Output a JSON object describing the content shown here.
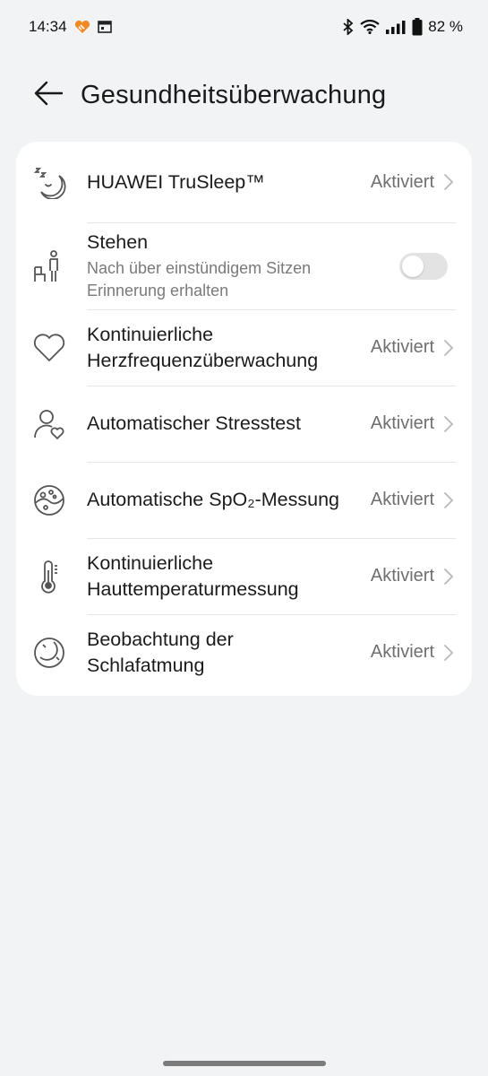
{
  "status_bar": {
    "time": "14:34",
    "icons_left": [
      "health-heart-icon",
      "calendar-icon"
    ],
    "icons_right": [
      "bluetooth-icon",
      "wifi-icon",
      "signal-icon",
      "battery-icon"
    ],
    "battery": "82 %"
  },
  "header": {
    "back_icon": "arrow-left-icon",
    "title": "Gesundheitsüberwachung"
  },
  "settings": [
    {
      "id": "trusleep",
      "icon": "sleep-moon-icon",
      "label": "HUAWEI TruSleep™",
      "value": "Aktiviert"
    },
    {
      "id": "stand",
      "icon": "standing-person-icon",
      "label": "Stehen",
      "sublabel": "Nach über einstündigem Sitzen Erinnerung erhalten",
      "toggle": false
    },
    {
      "id": "heartrate",
      "icon": "heart-icon",
      "label": "Kontinuierliche Herzfrequenzüberwachung",
      "value": "Aktiviert"
    },
    {
      "id": "stress",
      "icon": "person-heart-icon",
      "label": "Automatischer Stresstest",
      "value": "Aktiviert"
    },
    {
      "id": "spo2",
      "icon": "blood-oxygen-icon",
      "label": "Automatische SpO₂-Messung",
      "value": "Aktiviert"
    },
    {
      "id": "skintemp",
      "icon": "thermometer-icon",
      "label": "Kontinuierliche Hauttemperaturmessung",
      "value": "Aktiviert"
    },
    {
      "id": "breathing",
      "icon": "sleep-breathing-icon",
      "label": "Beobachtung der Schlafatmung",
      "value": "Aktiviert"
    }
  ],
  "colors": {
    "background": "#f1f3f5",
    "card": "#ffffff",
    "accent_health": "#f08a24",
    "toggle_off": "#e3e3e3"
  }
}
